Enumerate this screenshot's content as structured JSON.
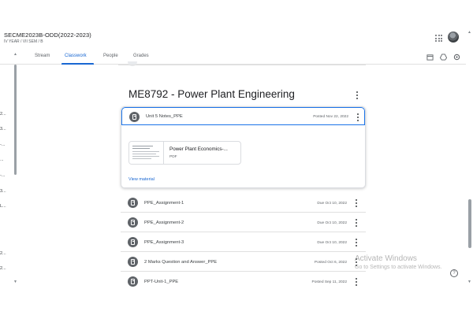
{
  "header": {
    "class_title": "SECME2023B-ODD(2022-2023)",
    "class_subtitle": "IV YEAR / VII SEM / B",
    "apps_icon": "apps-grid-icon",
    "avatar_icon": "user-avatar"
  },
  "tabs": [
    {
      "label": "Stream"
    },
    {
      "label": "Classwork",
      "active": true
    },
    {
      "label": "People"
    },
    {
      "label": "Grades"
    }
  ],
  "toolbar_icons": [
    "calendar-icon",
    "drive-icon",
    "settings-icon"
  ],
  "sidebar": {
    "items": [
      "2...",
      "3...",
      "-...",
      "...",
      "-...",
      "3...",
      "L...",
      "2...",
      "2..."
    ]
  },
  "topic": {
    "title": "ME8792 - Power Plant Engineering"
  },
  "expanded_item": {
    "title": "Unit 5 Notes_PPE",
    "date": "Posted Nov 22, 2022",
    "icon": "material-icon",
    "attachment": {
      "name": "Power Plant Economics-...",
      "type": "PDF"
    },
    "view_label": "View material"
  },
  "items": [
    {
      "title": "PPE_Assignment-1",
      "date": "Due Oct 10, 2022",
      "icon": "assignment-icon"
    },
    {
      "title": "PPE_Assignment-2",
      "date": "Due Oct 10, 2022",
      "icon": "assignment-icon"
    },
    {
      "title": "PPE_Assignment-3",
      "date": "Due Oct 10, 2022",
      "icon": "assignment-icon"
    },
    {
      "title": "2 Marks Question and Answer_PPE",
      "date": "Posted Oct 6, 2022",
      "icon": "material-icon"
    },
    {
      "title": "PPT-Unit-1_PPE",
      "date": "Posted Sep 11, 2022",
      "icon": "material-icon"
    }
  ],
  "watermark": {
    "title": "Activate Windows",
    "subtitle": "Go to Settings to activate Windows."
  },
  "help_label": "?",
  "colors": {
    "accent": "#1967d2",
    "icon_gray": "#5f6368",
    "border": "#dadce0"
  }
}
